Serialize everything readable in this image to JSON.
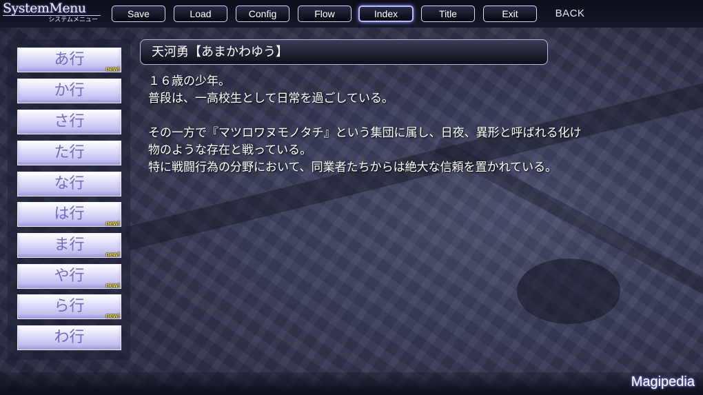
{
  "logo": {
    "main": "SystemMenu",
    "sub": "システムメニュー"
  },
  "menu": {
    "save": "Save",
    "load": "Load",
    "config": "Config",
    "flow": "Flow",
    "index": "Index",
    "title": "Title",
    "exit": "Exit",
    "back": "BACK",
    "active": "Index"
  },
  "sidebar": {
    "items": [
      {
        "label": "あ行",
        "badge": "new!"
      },
      {
        "label": "か行",
        "badge": ""
      },
      {
        "label": "さ行",
        "badge": ""
      },
      {
        "label": "た行",
        "badge": ""
      },
      {
        "label": "な行",
        "badge": ""
      },
      {
        "label": "は行",
        "badge": "new!"
      },
      {
        "label": "ま行",
        "badge": "new!"
      },
      {
        "label": "や行",
        "badge": "new!"
      },
      {
        "label": "ら行",
        "badge": "new!"
      },
      {
        "label": "わ行",
        "badge": ""
      }
    ]
  },
  "entry": {
    "title": "天河勇【あまかわゆう】",
    "lines": [
      "１６歳の少年。",
      "普段は、一高校生として日常を過ごしている。",
      "",
      "その一方で『マツロワヌモノタチ』という集団に属し、日夜、異形と呼ばれる化け",
      "物のような存在と戦っている。",
      "特に戦闘行為の分野において、同業者たちからは絶大な信頼を置かれている。"
    ]
  },
  "footer": {
    "label": "Magipedia"
  },
  "colors": {
    "badge": "#f4e21a",
    "side_text": "#6f6ccb",
    "active_glow": "#8c8fff"
  }
}
